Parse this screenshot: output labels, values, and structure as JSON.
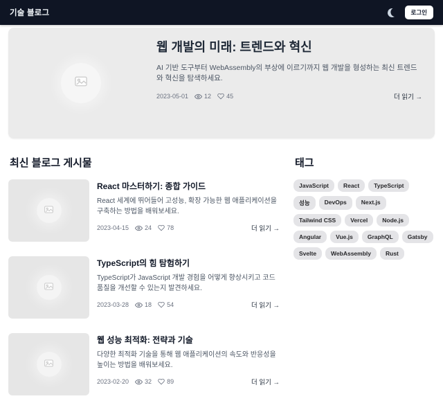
{
  "colors": {
    "header_bg": "#0f1524",
    "hero_bg": "#ebebeb",
    "thumb_bg": "#e6e6e6",
    "tag_bg": "#e4e4e7",
    "title_text": "#111827",
    "body_text": "#4b5563",
    "meta_text": "#6b7280"
  },
  "icons": {
    "theme_toggle": "moon-icon",
    "views": "eye-icon",
    "likes": "heart-icon",
    "media_placeholder": "image-icon"
  },
  "header": {
    "brand": "기술 블로그",
    "login_label": "로그인"
  },
  "hero": {
    "title": "웹 개발의 미래: 트렌드와 혁신",
    "description": "AI 기반 도구부터 WebAssembly의 부상에 이르기까지 웹 개발을 형성하는 최신 트렌드와 혁신을 탐색하세요.",
    "date": "2023-05-01",
    "views": "12",
    "likes": "45",
    "read_more": "더 읽기 →"
  },
  "posts": {
    "heading": "최신 블로그 게시물",
    "read_more": "더 읽기 →",
    "items": [
      {
        "title": "React 마스터하기: 종합 가이드",
        "description": "React 세계에 뛰어들어 고성능, 확장 가능한 웹 애플리케이션을 구축하는 방법을 배워보세요.",
        "date": "2023-04-15",
        "views": "24",
        "likes": "78"
      },
      {
        "title": "TypeScript의 힘 탐험하기",
        "description": "TypeScript가 JavaScript 개발 경험을 어떻게 향상시키고 코드 품질을 개선할 수 있는지 발견하세요.",
        "date": "2023-03-28",
        "views": "18",
        "likes": "54"
      },
      {
        "title": "웹 성능 최적화: 전략과 기술",
        "description": "다양한 최적화 기술을 통해 웹 애플리케이션의 속도와 반응성을 높이는 방법을 배워보세요.",
        "date": "2023-02-20",
        "views": "32",
        "likes": "89"
      }
    ]
  },
  "tags": {
    "heading": "태그",
    "items": [
      "JavaScript",
      "React",
      "TypeScript",
      "성능",
      "DevOps",
      "Next.js",
      "Tailwind CSS",
      "Vercel",
      "Node.js",
      "Angular",
      "Vue.js",
      "GraphQL",
      "Gatsby",
      "Svelte",
      "WebAssembly",
      "Rust"
    ]
  }
}
